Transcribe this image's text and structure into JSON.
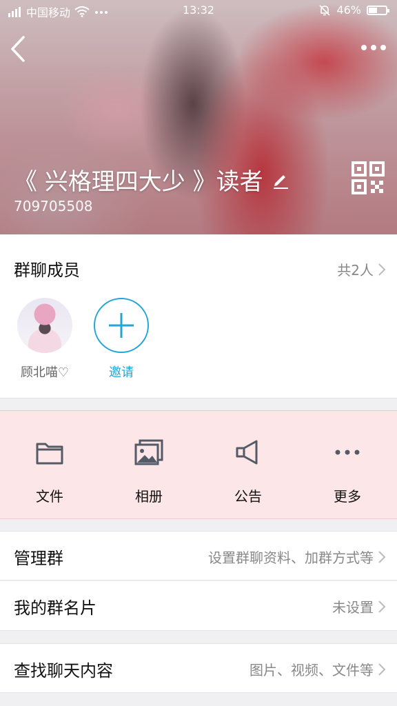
{
  "status_bar": {
    "carrier": "中国移动",
    "time": "13:32",
    "battery": "46%",
    "battery_level": 0.46
  },
  "header": {
    "group_name": "《 兴格理四大少 》读者",
    "group_id": "709705508"
  },
  "members": {
    "title": "群聊成员",
    "count": "共2人",
    "list": [
      {
        "name": "顾北喵♡"
      },
      {
        "name": "邀请"
      }
    ]
  },
  "actions": [
    {
      "label": "文件",
      "icon": "folder-icon"
    },
    {
      "label": "相册",
      "icon": "album-icon"
    },
    {
      "label": "公告",
      "icon": "megaphone-icon"
    },
    {
      "label": "更多",
      "icon": "more-dots-icon"
    }
  ],
  "rows": [
    {
      "label": "管理群",
      "value": "设置群聊资料、加群方式等"
    },
    {
      "label": "我的群名片",
      "value": "未设置"
    },
    {
      "label": "查找聊天内容",
      "value": "图片、视频、文件等"
    }
  ],
  "colors": {
    "accent": "#22a6d6",
    "actions_bg": "#fde6e8"
  }
}
